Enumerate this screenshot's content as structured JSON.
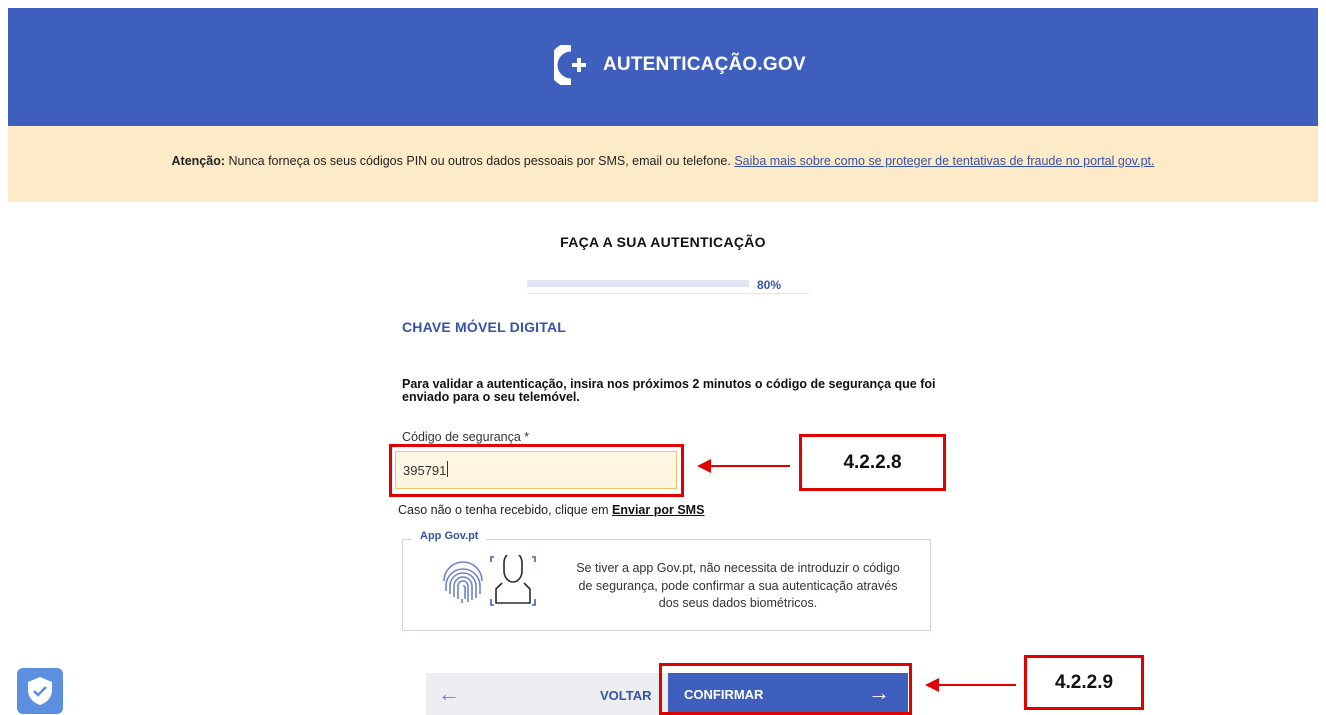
{
  "header": {
    "brand": "AUTENTICAÇÃO.GOV",
    "bg_color": "#3f5fbf"
  },
  "warning": {
    "prefix": "Atenção:",
    "text": " Nunca forneça os seus códigos PIN ou outros dados pessoais por SMS, email ou telefone. ",
    "link": "Saiba mais sobre como se proteger de tentativas de fraude no portal gov.pt.",
    "bg_color": "#fdebc8"
  },
  "page": {
    "title": "FAÇA A SUA AUTENTICAÇÃO",
    "progress_label": "80%",
    "progress_value": 0.8
  },
  "section": {
    "title": "CHAVE MÓVEL DIGITAL",
    "instructions": "Para validar a autenticação, insira nos próximos 2 minutos o código de segurança que foi enviado para o seu telemóvel."
  },
  "form": {
    "code_label": "Código de segurança *",
    "code_value": "395791",
    "resend_prefix": "Caso não o tenha recebido, clique em ",
    "resend_link": "Enviar por SMS"
  },
  "app": {
    "legend": "App Gov.pt",
    "text": "Se tiver a app Gov.pt, não necessita de introduzir o código de segurança, pode confirmar a sua autenticação através dos seus dados biométricos."
  },
  "buttons": {
    "back": "VOLTAR",
    "confirm": "CONFIRMAR"
  },
  "annotations": {
    "input": "4.2.2.8",
    "confirm": "4.2.2.9",
    "color": "#e00000"
  },
  "icons": {
    "logo": "gov-logo-icon",
    "fingerprint": "fingerprint-icon",
    "face": "face-scan-icon",
    "back": "arrow-left-icon",
    "confirm": "arrow-right-icon",
    "shield": "shield-check-icon"
  }
}
